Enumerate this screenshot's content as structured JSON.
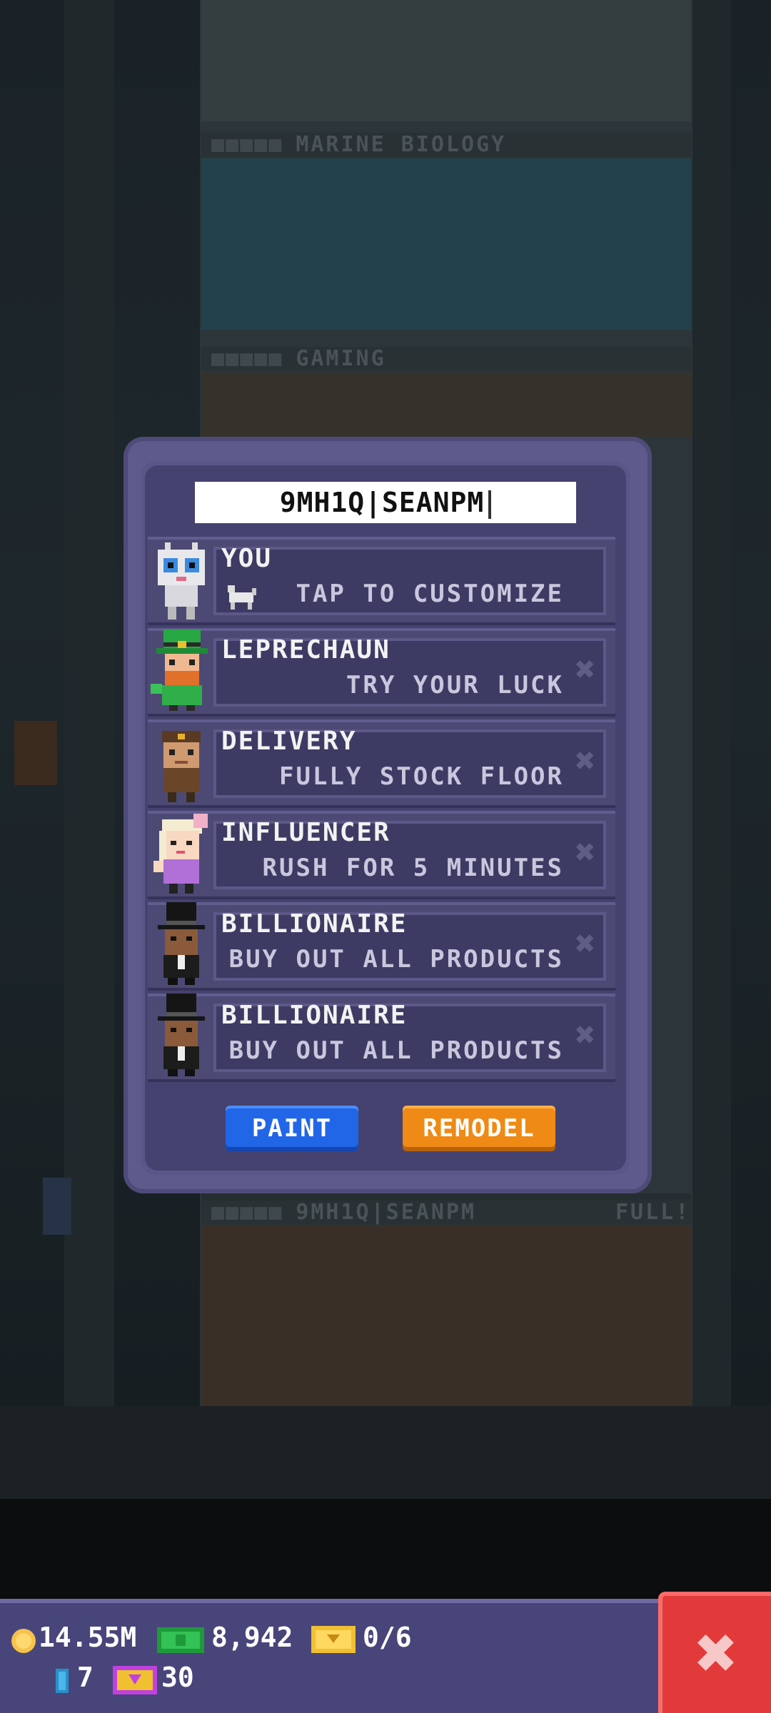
{
  "background": {
    "floors": [
      {
        "name": "MARINE BIOLOGY"
      },
      {
        "name": "GAMING"
      },
      {
        "name": "9MH1Q|SEANPM",
        "status": "FULL!"
      }
    ]
  },
  "modal": {
    "floor_name_value": "9MH1Q|SEANPM",
    "rows": [
      {
        "title": "YOU",
        "subtitle": "TAP TO CUSTOMIZE",
        "avatar": "robot-avatar-icon",
        "removable": false
      },
      {
        "title": "LEPRECHAUN",
        "subtitle": "TRY YOUR LUCK",
        "avatar": "leprechaun-avatar-icon",
        "removable": true
      },
      {
        "title": "DELIVERY",
        "subtitle": "FULLY STOCK FLOOR",
        "avatar": "delivery-avatar-icon",
        "removable": true
      },
      {
        "title": "INFLUENCER",
        "subtitle": "RUSH FOR 5 MINUTES",
        "avatar": "influencer-avatar-icon",
        "removable": true
      },
      {
        "title": "BILLIONAIRE",
        "subtitle": "BUY OUT ALL PRODUCTS",
        "avatar": "billionaire-avatar-icon",
        "removable": true
      },
      {
        "title": "BILLIONAIRE",
        "subtitle": "BUY OUT ALL PRODUCTS",
        "avatar": "billionaire-avatar-icon",
        "removable": true
      }
    ],
    "paint_label": "PAINT",
    "remodel_label": "REMODEL"
  },
  "hud": {
    "coins": "14.55M",
    "bux": "8,942",
    "tickets": "0/6",
    "keys": "7",
    "golden_tickets": "30"
  },
  "colors": {
    "paint_button": "#2266e8",
    "remodel_button": "#ef8a16",
    "close_button": "#e23a3a",
    "panel": "#45426f"
  }
}
